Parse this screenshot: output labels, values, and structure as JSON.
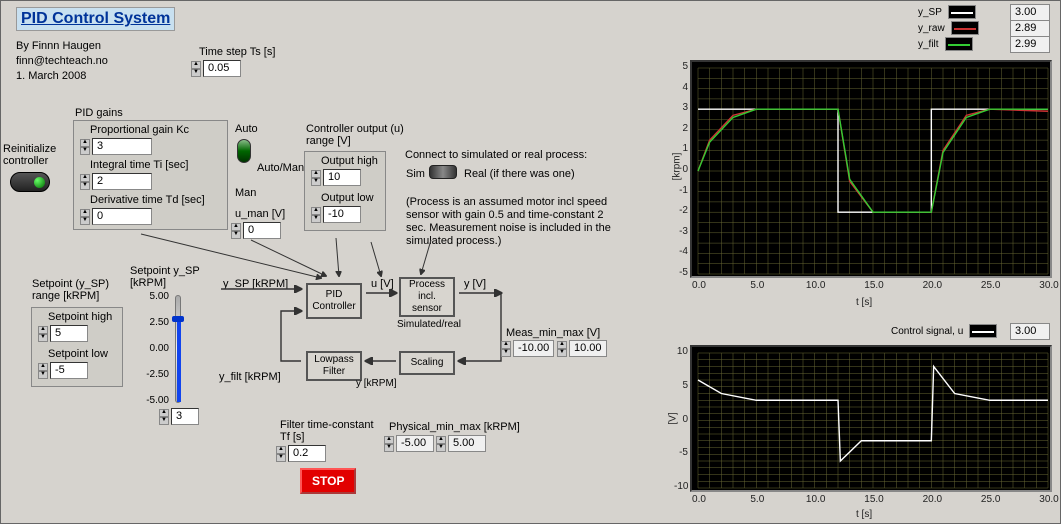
{
  "title": "PID Control System",
  "author": "By Finnn Haugen",
  "email": "finn@techteach.no",
  "date": "1. March 2008",
  "timestep": {
    "label": "Time step Ts [s]",
    "value": "0.05"
  },
  "reinit_label": "Reinitialize\ncontroller",
  "pid_gains": {
    "group_label": "PID gains",
    "kc": {
      "label": "Proportional gain Kc",
      "value": "3"
    },
    "ti": {
      "label": "Integral time Ti [sec]",
      "value": "2"
    },
    "td": {
      "label": "Derivative time Td [sec]",
      "value": "0"
    }
  },
  "automan": {
    "auto": "Auto",
    "man": "Man",
    "label": "Auto/Man?"
  },
  "u_man": {
    "label": "u_man [V]",
    "value": "0"
  },
  "u_range": {
    "label": "Controller output (u)\nrange [V]",
    "high_label": "Output high",
    "high": "10",
    "low_label": "Output low",
    "low": "-10"
  },
  "process_sel": {
    "label": "Connect to simulated or real process:",
    "sim": "Sim",
    "real": "Real (if there was one)",
    "note": "(Process is an assumed motor incl speed sensor with gain 0.5 and time-constant 2 sec. Measurement noise is included in the simulated process.)"
  },
  "setpoint_range": {
    "label": "Setpoint (y_SP)\nrange [kRPM]",
    "high_label": "Setpoint high",
    "high": "5",
    "low_label": "Setpoint low",
    "low": "-5"
  },
  "slider": {
    "label": "Setpoint y_SP\n[kRPM]",
    "ticks": [
      "5.00",
      "2.50",
      "0.00",
      "-2.50",
      "-5.00"
    ],
    "value": "3"
  },
  "diagram": {
    "y_sp": "y_SP [kRPM]",
    "pid": "PID\nController",
    "u": "u [V]",
    "process": "Process\nincl.\nsensor",
    "simreal": "Simulated/real",
    "y": "y [V]",
    "lowpass": "Lowpass\nFilter",
    "scaling": "Scaling",
    "y_filt": "y_filt [kRPM]",
    "y_krpm": "y [kRPM]"
  },
  "meas": {
    "label": "Meas_min_max [V]",
    "min": "-10.00",
    "max": "10.00"
  },
  "phys": {
    "label": "Physical_min_max [kRPM]",
    "min": "-5.00",
    "max": "5.00"
  },
  "filter_tc": {
    "label": "Filter time-constant\nTf [s]",
    "value": "0.2"
  },
  "stop": "STOP",
  "chart_top": {
    "legend": [
      {
        "name": "y_SP",
        "color": "#ffffff",
        "value": "3.00"
      },
      {
        "name": "y_raw",
        "color": "#cc3333",
        "value": "2.89"
      },
      {
        "name": "y_filt",
        "color": "#33cc33",
        "value": "2.99"
      }
    ],
    "xlabel": "t [s]",
    "ylabel": "[krpm]",
    "xlim": [
      0,
      30
    ],
    "ylim": [
      -5,
      5
    ],
    "xticks": [
      "0.0",
      "5.0",
      "10.0",
      "15.0",
      "20.0",
      "25.0",
      "30.0"
    ],
    "yticks": [
      "-5",
      "-4",
      "-3",
      "-2",
      "-1",
      "0",
      "1",
      "2",
      "3",
      "4",
      "5"
    ]
  },
  "chart_bot": {
    "legend": [
      {
        "name": "Control signal, u",
        "color": "#ffffff",
        "value": "3.00"
      }
    ],
    "xlabel": "t [s]",
    "ylabel": "[V]",
    "xlim": [
      0,
      30
    ],
    "ylim": [
      -10,
      10
    ],
    "xticks": [
      "0.0",
      "5.0",
      "10.0",
      "15.0",
      "20.0",
      "25.0",
      "30.0"
    ],
    "yticks": [
      "-10",
      "-5",
      "0",
      "5",
      "10"
    ]
  },
  "chart_data": [
    {
      "type": "line",
      "title": "",
      "xlabel": "t [s]",
      "ylabel": "[krpm]",
      "xlim": [
        0,
        30
      ],
      "ylim": [
        -5,
        5
      ],
      "series": [
        {
          "name": "y_SP",
          "x": [
            0,
            1,
            12,
            12,
            20,
            20,
            30
          ],
          "values": [
            3,
            3,
            3,
            -2,
            -2,
            3,
            3
          ]
        },
        {
          "name": "y_raw",
          "x": [
            0,
            1,
            3,
            5,
            12,
            13,
            15,
            20,
            21,
            23,
            25,
            30
          ],
          "values": [
            0,
            1.5,
            2.7,
            3,
            3,
            -0.5,
            -2,
            -2,
            1,
            2.7,
            3,
            2.9
          ]
        },
        {
          "name": "y_filt",
          "x": [
            0,
            1,
            3,
            5,
            12,
            13,
            15,
            20,
            21,
            23,
            25,
            30
          ],
          "values": [
            0,
            1.4,
            2.6,
            3,
            3,
            -0.4,
            -2,
            -2,
            0.9,
            2.6,
            3,
            3
          ]
        }
      ]
    },
    {
      "type": "line",
      "title": "Control signal, u",
      "xlabel": "t [s]",
      "ylabel": "[V]",
      "xlim": [
        0,
        30
      ],
      "ylim": [
        -10,
        10
      ],
      "series": [
        {
          "name": "u",
          "x": [
            0,
            0.5,
            2,
            5,
            12,
            12.2,
            14,
            20,
            20.2,
            22,
            25,
            30
          ],
          "values": [
            6,
            5.5,
            4,
            3,
            3,
            -6,
            -3,
            -3,
            8,
            4,
            3,
            3
          ]
        }
      ]
    }
  ]
}
